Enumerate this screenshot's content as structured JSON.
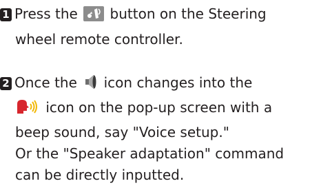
{
  "step1": {
    "number": "1",
    "text_before": "Press the",
    "icon": "voice-recognition-button-icon",
    "text_after": "button on the Steering",
    "line2": "wheel remote controller."
  },
  "step2": {
    "number": "2",
    "line1_before": "Once the",
    "icon_speaker": "speaker-icon",
    "line1_after": "icon changes into the",
    "icon_talk": "talking-head-icon",
    "line2_after": "icon on the pop-up screen with a",
    "line3": "beep sound, say \"Voice setup.\"",
    "line4": "Or the \"Speaker adaptation\" command",
    "line5": "can be directly inputted."
  },
  "colors": {
    "text": "#231f20",
    "icon_box": "#8c8c8c",
    "talk_red": "#d7262d",
    "sound_yellow": "#f2b705"
  }
}
